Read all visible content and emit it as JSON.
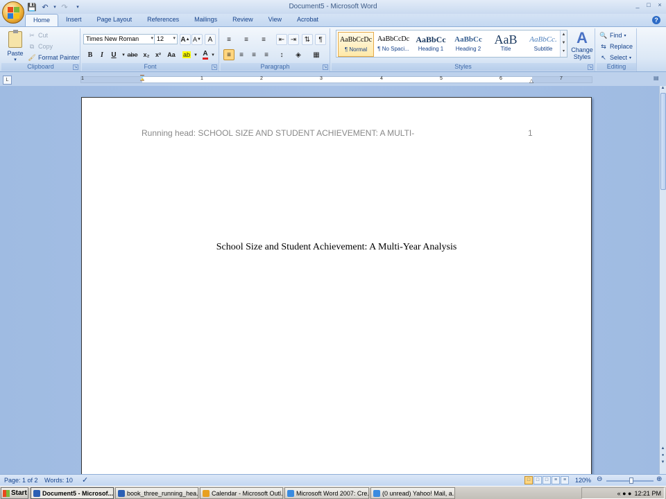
{
  "window": {
    "title": "Document5 - Microsoft Word",
    "controls": [
      "_",
      "□",
      "×"
    ]
  },
  "tabs": [
    "Home",
    "Insert",
    "Page Layout",
    "References",
    "Mailings",
    "Review",
    "View",
    "Acrobat"
  ],
  "clipboard": {
    "paste": "Paste",
    "cut": "Cut",
    "copy": "Copy",
    "format_painter": "Format Painter",
    "label": "Clipboard"
  },
  "font": {
    "name": "Times New Roman",
    "size": "12",
    "label": "Font",
    "bold": "B",
    "italic": "I",
    "underline": "U",
    "strike": "abe",
    "subscript": "x₂",
    "superscript": "x²",
    "change_case": "Aa",
    "grow": "A",
    "shrink": "A",
    "clear": "A"
  },
  "paragraph": {
    "label": "Paragraph",
    "show_marks": "¶"
  },
  "styles": {
    "label": "Styles",
    "items": [
      {
        "preview": "AaBbCcDc",
        "name": "¶ Normal"
      },
      {
        "preview": "AaBbCcDc",
        "name": "¶ No Spaci..."
      },
      {
        "preview": "AaBbCc",
        "name": "Heading 1"
      },
      {
        "preview": "AaBbCc",
        "name": "Heading 2"
      },
      {
        "preview": "AaB",
        "name": "Title"
      },
      {
        "preview": "AaBbCc.",
        "name": "Subtitle"
      }
    ],
    "change_styles": "Change Styles"
  },
  "editing": {
    "label": "Editing",
    "find": "Find",
    "replace": "Replace",
    "select": "Select"
  },
  "ruler": {
    "numbers": [
      "1",
      "1",
      "2",
      "3",
      "4",
      "5",
      "6",
      "7"
    ]
  },
  "document": {
    "running_head": "Running head: SCHOOL SIZE AND STUDENT ACHIEVEMENT: A MULTI-",
    "page_number": "1",
    "title": "School Size and Student Achievement: A Multi-Year Analysis"
  },
  "status": {
    "page": "Page: 1 of 2",
    "words": "Words: 10",
    "zoom": "120%",
    "zoom_level_percent": 120
  },
  "taskbar": {
    "start": "Start",
    "tasks": [
      "Document5 - Microsof...",
      "book_three_running_hea...",
      "Calendar - Microsoft Outl...",
      "Microsoft Word 2007: Cre...",
      "(0 unread) Yahoo! Mail, a..."
    ],
    "clock": "12:21 PM"
  },
  "colors": {
    "ribbon_blue": "#c4d8f1",
    "doc_bg": "#a9c2e6",
    "header_gray": "#888888"
  }
}
